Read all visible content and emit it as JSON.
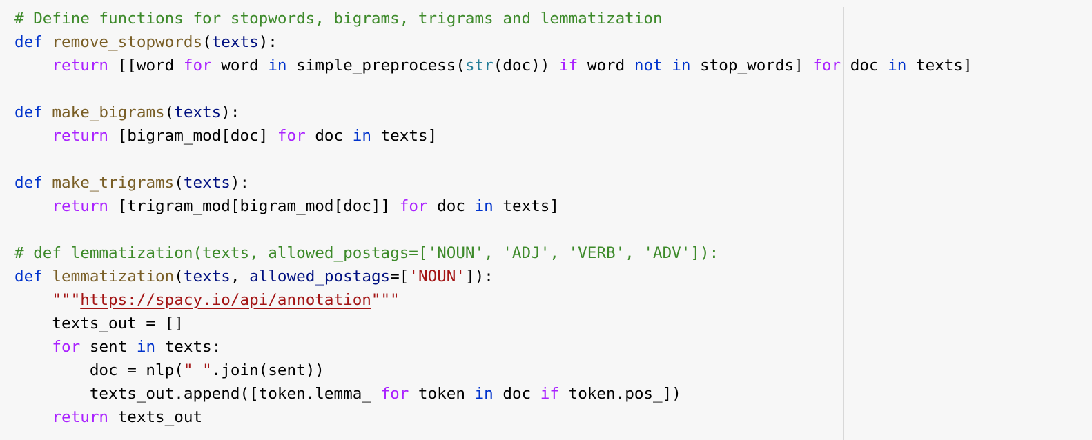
{
  "theme": {
    "background": "#f7f7f7",
    "ruler_color": "#d8d8d8",
    "comment_color": "#3d8a2a",
    "keyword_color": "#0033cc",
    "control_color": "#aa22ff",
    "function_name_color": "#795e26",
    "param_color": "#001080",
    "builtin_color": "#267f99",
    "string_color": "#a31515"
  },
  "code": {
    "lines": [
      [
        {
          "t": "comment",
          "v": "# Define functions for stopwords, bigrams, trigrams and lemmatization"
        }
      ],
      [
        {
          "t": "keyword",
          "v": "def "
        },
        {
          "t": "funcname",
          "v": "remove_stopwords"
        },
        {
          "t": "plain",
          "v": "("
        },
        {
          "t": "param",
          "v": "texts"
        },
        {
          "t": "plain",
          "v": "):"
        }
      ],
      [
        {
          "t": "plain",
          "v": "    "
        },
        {
          "t": "control",
          "v": "return"
        },
        {
          "t": "plain",
          "v": " [[word "
        },
        {
          "t": "control",
          "v": "for"
        },
        {
          "t": "plain",
          "v": " word "
        },
        {
          "t": "keyword",
          "v": "in"
        },
        {
          "t": "plain",
          "v": " simple_preprocess("
        },
        {
          "t": "builtin",
          "v": "str"
        },
        {
          "t": "plain",
          "v": "(doc)) "
        },
        {
          "t": "control",
          "v": "if"
        },
        {
          "t": "plain",
          "v": " word "
        },
        {
          "t": "keyword",
          "v": "not in"
        },
        {
          "t": "plain",
          "v": " stop_words] "
        },
        {
          "t": "control",
          "v": "for"
        },
        {
          "t": "plain",
          "v": " doc "
        },
        {
          "t": "keyword",
          "v": "in"
        },
        {
          "t": "plain",
          "v": " texts]"
        }
      ],
      [],
      [
        {
          "t": "keyword",
          "v": "def "
        },
        {
          "t": "funcname",
          "v": "make_bigrams"
        },
        {
          "t": "plain",
          "v": "("
        },
        {
          "t": "param",
          "v": "texts"
        },
        {
          "t": "plain",
          "v": "):"
        }
      ],
      [
        {
          "t": "plain",
          "v": "    "
        },
        {
          "t": "control",
          "v": "return"
        },
        {
          "t": "plain",
          "v": " [bigram_mod[doc] "
        },
        {
          "t": "control",
          "v": "for"
        },
        {
          "t": "plain",
          "v": " doc "
        },
        {
          "t": "keyword",
          "v": "in"
        },
        {
          "t": "plain",
          "v": " texts]"
        }
      ],
      [],
      [
        {
          "t": "keyword",
          "v": "def "
        },
        {
          "t": "funcname",
          "v": "make_trigrams"
        },
        {
          "t": "plain",
          "v": "("
        },
        {
          "t": "param",
          "v": "texts"
        },
        {
          "t": "plain",
          "v": "):"
        }
      ],
      [
        {
          "t": "plain",
          "v": "    "
        },
        {
          "t": "control",
          "v": "return"
        },
        {
          "t": "plain",
          "v": " [trigram_mod[bigram_mod[doc]] "
        },
        {
          "t": "control",
          "v": "for"
        },
        {
          "t": "plain",
          "v": " doc "
        },
        {
          "t": "keyword",
          "v": "in"
        },
        {
          "t": "plain",
          "v": " texts]"
        }
      ],
      [],
      [
        {
          "t": "comment",
          "v": "# def lemmatization(texts, allowed_postags=['NOUN', 'ADJ', 'VERB', 'ADV']):"
        }
      ],
      [
        {
          "t": "keyword",
          "v": "def "
        },
        {
          "t": "funcname",
          "v": "lemmatization"
        },
        {
          "t": "plain",
          "v": "("
        },
        {
          "t": "param",
          "v": "texts"
        },
        {
          "t": "plain",
          "v": ", "
        },
        {
          "t": "param",
          "v": "allowed_postags"
        },
        {
          "t": "plain",
          "v": "=["
        },
        {
          "t": "string",
          "v": "'NOUN'"
        },
        {
          "t": "plain",
          "v": "]):"
        }
      ],
      [
        {
          "t": "plain",
          "v": "    "
        },
        {
          "t": "string",
          "v": "\"\"\""
        },
        {
          "t": "link",
          "v": "https://spacy.io/api/annotation"
        },
        {
          "t": "string",
          "v": "\"\"\""
        }
      ],
      [
        {
          "t": "plain",
          "v": "    texts_out = []"
        }
      ],
      [
        {
          "t": "plain",
          "v": "    "
        },
        {
          "t": "control",
          "v": "for"
        },
        {
          "t": "plain",
          "v": " sent "
        },
        {
          "t": "keyword",
          "v": "in"
        },
        {
          "t": "plain",
          "v": " texts:"
        }
      ],
      [
        {
          "t": "plain",
          "v": "        doc = nlp("
        },
        {
          "t": "string",
          "v": "\" \""
        },
        {
          "t": "plain",
          "v": ".join(sent))"
        }
      ],
      [
        {
          "t": "plain",
          "v": "        texts_out.append([token.lemma_ "
        },
        {
          "t": "control",
          "v": "for"
        },
        {
          "t": "plain",
          "v": " token "
        },
        {
          "t": "keyword",
          "v": "in"
        },
        {
          "t": "plain",
          "v": " doc "
        },
        {
          "t": "control",
          "v": "if"
        },
        {
          "t": "plain",
          "v": " token.pos_])"
        }
      ],
      [
        {
          "t": "plain",
          "v": "    "
        },
        {
          "t": "control",
          "v": "return"
        },
        {
          "t": "plain",
          "v": " texts_out"
        }
      ]
    ]
  }
}
